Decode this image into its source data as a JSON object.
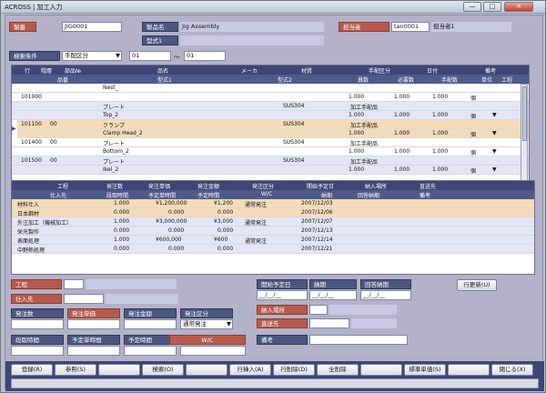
{
  "window": {
    "title": "ACROSS | 加工入力",
    "min": "—",
    "max": "□",
    "close": "✕"
  },
  "header": {
    "seiban_label": "製番",
    "seiban_value": "JIG0001",
    "product_label": "製品名",
    "product_value": "Jig Assembly",
    "model_label": "型式1",
    "model_value": "",
    "staff_label": "担当者",
    "staff_code": "tan0001",
    "staff_name": "担当者1",
    "search_label": "検索条件",
    "search_value": "手配区分",
    "from": "01",
    "tilde": "～",
    "to": "01"
  },
  "grid": {
    "headers_top": [
      "行",
      "階層",
      "部品№",
      "品名",
      "メーカ",
      "材質",
      "手配区分",
      "日付",
      "備考"
    ],
    "headers_bottom": [
      "品番",
      "型式1",
      "型式2",
      "員数",
      "必要数",
      "手配数",
      "単位",
      "工程"
    ],
    "rows": [
      {
        "sel": false,
        "row": "",
        "level": "",
        "part": "",
        "name": "Nest_",
        "maker": "",
        "material": "",
        "tehai": "",
        "date": "",
        "note": "",
        "hinban": "",
        "model1": "",
        "model2": "",
        "qty": "1.000",
        "need": "1.000",
        "order": "1.000",
        "unit": "個",
        "step": ""
      },
      {
        "sel": false,
        "row": "",
        "level": "",
        "part": "",
        "name": "プレート",
        "maker": "",
        "material": "SUS304",
        "tehai": "加工手配品",
        "date": "",
        "note": "",
        "hinban": "",
        "model1": "Top_2",
        "model2": "",
        "qty": "1.000",
        "need": "1.000",
        "order": "1.000",
        "unit": "個",
        "step": "▼",
        "blue": true
      },
      {
        "sel": true,
        "row": "101100",
        "level": "00",
        "part": "",
        "name": "クランプ",
        "maker": "",
        "material": "SUS304",
        "tehai": "加工手配品",
        "date": "",
        "note": "",
        "hinban": "",
        "model1": "Clamp Head_2",
        "model2": "",
        "qty": "1.000",
        "need": "1.000",
        "order": "1.000",
        "unit": "個",
        "step": "▼",
        "orange": true
      },
      {
        "sel": false,
        "row": "101400",
        "level": "00",
        "part": "",
        "name": "プレート",
        "maker": "",
        "material": "SUS304",
        "tehai": "加工手配品",
        "date": "",
        "note": "",
        "hinban": "",
        "model1": "Bottom_2",
        "model2": "",
        "qty": "1.000",
        "need": "1.000",
        "order": "1.000",
        "unit": "個",
        "step": "▼"
      },
      {
        "sel": false,
        "row": "101500",
        "level": "00",
        "part": "",
        "name": "プレート",
        "maker": "",
        "material": "SUS304",
        "tehai": "加工手配品",
        "date": "",
        "note": "",
        "hinban": "",
        "model1": "Ikel_2",
        "model2": "",
        "qty": "1.000",
        "need": "1.000",
        "order": "1.000",
        "unit": "個",
        "step": "▼",
        "blue": true
      }
    ],
    "first_row_no": "101000"
  },
  "process": {
    "headers_top": [
      "工程",
      "発注数",
      "発注単価",
      "発注金額",
      "発注区分",
      "開始予定日",
      "納入場所",
      "直送先"
    ],
    "headers_bottom": [
      "仕入先",
      "段取時間",
      "予定単時間",
      "予定時間",
      "W/C",
      "納期",
      "回答納期",
      "備考"
    ],
    "rows": [
      {
        "step": "材料仕入",
        "qty": "1.000",
        "price": "¥1,200,000",
        "amount": "¥1,200",
        "kubun": "通常発注",
        "start": "2007/12/03",
        "vendor": "日本鋼材",
        "due": "2007/12/06",
        "c1": "0.000",
        "c2": "0.000",
        "c3": "0.000",
        "orange": true
      },
      {
        "step": "外注加工（機械加工）",
        "qty": "1.000",
        "price": "¥3,000,000",
        "amount": "¥3,000",
        "kubun": "通常発注",
        "start": "2007/12/07",
        "vendor": "栄光製作",
        "due": "2007/12/13",
        "c1": "0.000",
        "c2": "0.000",
        "c3": "0.000"
      },
      {
        "step": "表面処理",
        "qty": "1.000",
        "price": "¥600,000",
        "amount": "¥600",
        "kubun": "通常発注",
        "start": "2007/12/14",
        "vendor": "中野熱処理",
        "due": "2007/12/21",
        "c1": "0.000",
        "c2": "0.000",
        "c3": "0.000"
      }
    ]
  },
  "form": {
    "koutei": "工程",
    "shiire": "仕入先",
    "hatchusu": "発注数",
    "tanka": "発注単価",
    "kingaku": "発注金額",
    "kubun": "発注区分",
    "kubun_value": "通常発注",
    "dandori": "段取時間",
    "yotei_tan": "予定単時間",
    "yotei": "予定時間",
    "wc": "W/C",
    "kaishi": "開始予定日",
    "noki": "納期",
    "kaitou": "回答納期",
    "date_placeholder": "__/__/__",
    "nounyu": "納入場所",
    "chokuso": "直送先",
    "bikou": "備考",
    "update": "行更新(U)"
  },
  "footer": [
    "登録(R)",
    "参照(S)",
    "",
    "検索(O)",
    "",
    "行挿入(A)",
    "行削除(D)",
    "全削除",
    "",
    "標準単価(S)",
    "",
    "閉じる(X)"
  ]
}
